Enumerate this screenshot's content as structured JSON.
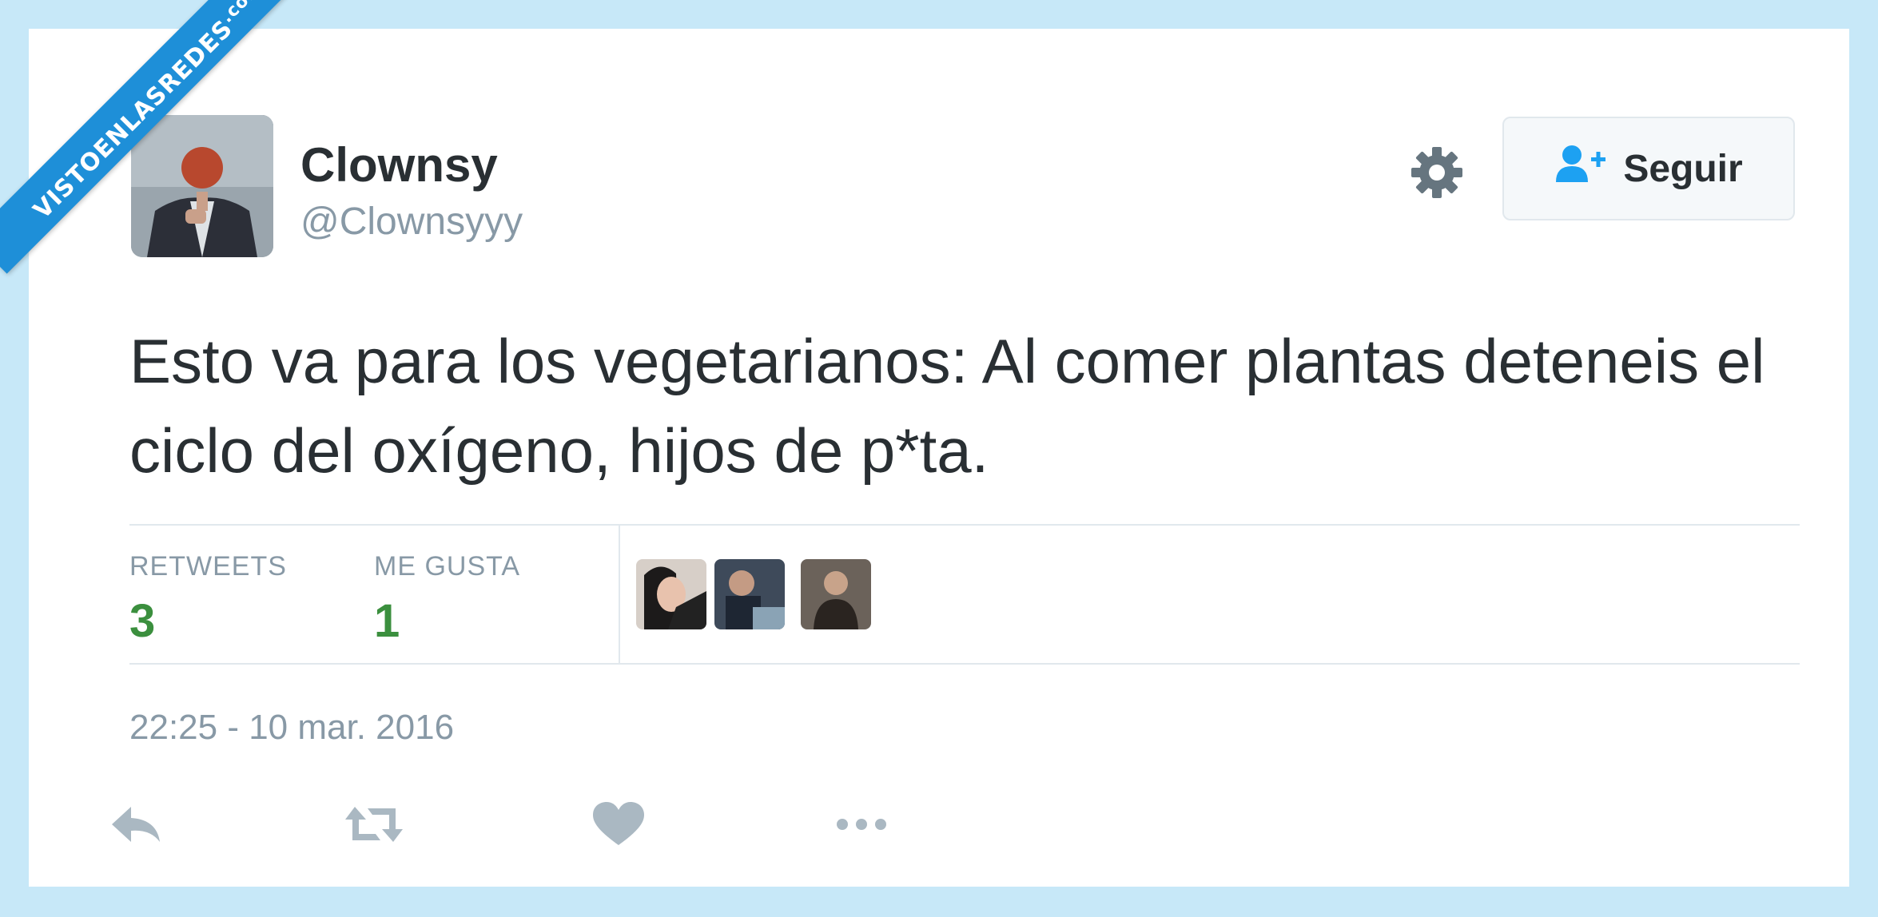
{
  "watermark": {
    "text": "VISTOENLASREDES",
    "suffix": ".com"
  },
  "user": {
    "display_name": "Clownsy",
    "handle": "@Clownsyyy"
  },
  "header": {
    "settings_icon": "gear-icon",
    "follow_label": "Seguir",
    "follow_icon": "follow-user-icon"
  },
  "tweet": {
    "text": "Esto va para los vegetarianos: Al comer plantas deteneis el ciclo del oxígeno, hijos de p*ta.",
    "timestamp": "22:25 - 10 mar. 2016"
  },
  "stats": [
    {
      "label": "RETWEETS",
      "value": "3"
    },
    {
      "label": "ME GUSTA",
      "value": "1"
    }
  ],
  "colors": {
    "accent": "#1da1f2",
    "stat_value": "#3b8f3e",
    "muted": "#8899a6",
    "text": "#292f33",
    "background": "#c7e8f8"
  },
  "actions": [
    "reply-icon",
    "retweet-icon",
    "like-icon",
    "more-icon"
  ]
}
